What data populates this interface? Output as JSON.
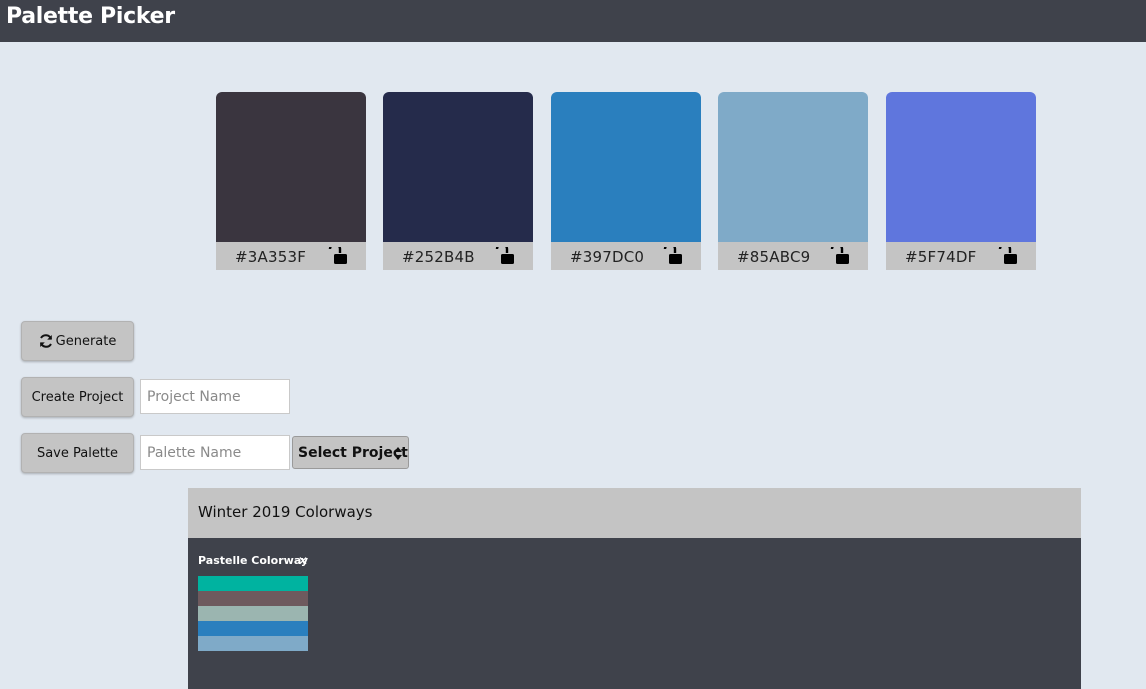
{
  "app": {
    "title": "Palette Picker"
  },
  "swatches": [
    {
      "hex": "#3A353F",
      "color": "#3A353F",
      "locked": false
    },
    {
      "hex": "#252B4B",
      "color": "#252B4B",
      "locked": false
    },
    {
      "hex": "#397DC0",
      "color": "#2A7FBE",
      "locked": false
    },
    {
      "hex": "#85ABC9",
      "color": "#7FAAC8",
      "locked": false
    },
    {
      "hex": "#5F74DF",
      "color": "#5F76DD",
      "locked": false
    }
  ],
  "controls": {
    "generate_label": "Generate",
    "create_project_label": "Create Project",
    "project_name_placeholder": "Project Name",
    "save_palette_label": "Save Palette",
    "palette_name_placeholder": "Palette Name",
    "select_project_label": "Select Project"
  },
  "project": {
    "name": "Winter 2019 Colorways",
    "palettes": [
      {
        "name": "Pastelle Colorway",
        "delete_glyph": "✕",
        "colors": [
          "#00B3A0",
          "#6E5A5E",
          "#9BB5B0",
          "#2A7FBE",
          "#7FAAC8"
        ]
      }
    ]
  },
  "icons": {
    "generate": "refresh-icon",
    "lock": "unlock-icon",
    "select": "sort-arrows-icon",
    "delete": "close-icon"
  },
  "theme": {
    "header_bg": "#3F424B",
    "page_bg": "#E1E8F0",
    "button_bg": "#C4C4C4"
  }
}
